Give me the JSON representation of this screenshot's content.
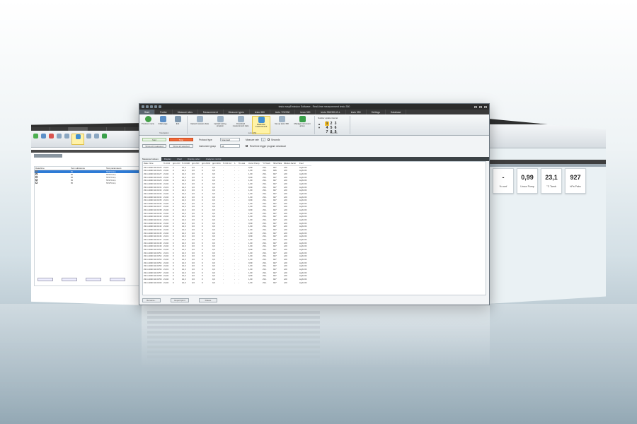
{
  "window": {
    "title": "testo easyEmission Software - Real-time measurement testo 350"
  },
  "menu": [
    {
      "label": "Start",
      "active": true
    },
    {
      "label": "Folder"
    },
    {
      "label": "Measure sites"
    },
    {
      "label": "Measurement"
    },
    {
      "label": "Measure types"
    },
    {
      "label": "testo 380"
    },
    {
      "label": "testo 720/330"
    },
    {
      "label": "testo 330"
    },
    {
      "label": "testo 330/330-2LL"
    },
    {
      "label": "testo 350"
    },
    {
      "label": "Settings"
    },
    {
      "label": "Database"
    }
  ],
  "ribbon": {
    "navigation": {
      "label": "Navigation",
      "buttons": [
        "Previous menu",
        "Initial page",
        "Exit"
      ]
    },
    "instrument": {
      "label": "testo 350",
      "buttons": [
        "Upload measure data",
        "Upload testing program",
        "Download measurement data",
        "Real-time measurement",
        "Set-up testo 350",
        "Manage instrument group"
      ]
    },
    "numpad": {
      "label": "Number update interval",
      "keys": [
        "1",
        "2",
        "3",
        "4",
        "5",
        "6",
        "7",
        "8",
        "9"
      ],
      "selected": "1",
      "group_label": "Specials"
    }
  },
  "controls": {
    "start": "Start",
    "stop": "Stop",
    "show_all_measured": "Show all measured",
    "show_all_selected": "Show all selected",
    "protocol_type_label": "Protocol type",
    "protocol_type_value": "Standard",
    "instrument_group_label": "Instrument group",
    "instrument_group_value": "All",
    "measure_rate_label": "Measure rate",
    "measure_rate_value": "1",
    "seconds_label": "Seconds",
    "trigger_label": "Real time trigger program download"
  },
  "tabs": [
    "Measured values",
    "Display",
    "Chart",
    "Display order",
    "Analyzer control"
  ],
  "table": {
    "headers": [
      "Date / time",
      "% CO2",
      "ppm CO",
      "% CO2R",
      "ppm NO",
      "ppm NO2",
      "ppm NOx",
      "% O2 Ind",
      "λ",
      "% Loss",
      "Uncor Pump",
      "°C Tamb",
      "hPa Pabs",
      "Dilution factor",
      "Fuel"
    ],
    "rows": [
      [
        "23.11.2020 11:02:25",
        "21,01",
        "0",
        "12,3",
        "0,0",
        "0",
        "0,0",
        "-",
        "-",
        "-",
        "0,99",
        "23,1",
        "927",
        "x20",
        "Light Oil"
      ],
      [
        "23.11.2020 11:02:26",
        "21,02",
        "0",
        "12,3",
        "0,0",
        "0",
        "0,0",
        "-",
        "-",
        "-",
        "1,00",
        "23,1",
        "926",
        "x20",
        "Light Oil"
      ],
      [
        "23.11.2020 11:02:27",
        "21,02",
        "0",
        "12,3",
        "0,0",
        "0",
        "0,0",
        "-",
        "-",
        "-",
        "1,00",
        "23,1",
        "927",
        "x20",
        "Light Oil"
      ],
      [
        "23.11.2020 11:02:28",
        "21,02",
        "0",
        "12,3",
        "0,0",
        "0",
        "0,0",
        "-",
        "-",
        "-",
        "0,99",
        "23,1",
        "927",
        "x20",
        "Light Oil"
      ],
      [
        "23.11.2020 11:02:29",
        "21,02",
        "0",
        "12,3",
        "0,0",
        "0",
        "0,0",
        "-",
        "-",
        "-",
        "1,00",
        "23,1",
        "927",
        "x20",
        "Light Oil"
      ],
      [
        "23.11.2020 11:02:30",
        "21,02",
        "0",
        "12,3",
        "0,0",
        "0",
        "0,0",
        "-",
        "-",
        "-",
        "1,00",
        "23,1",
        "927",
        "x20",
        "Light Oil"
      ],
      [
        "23.11.2020 11:02:31",
        "21,01",
        "0",
        "12,3",
        "0,0",
        "0",
        "0,0",
        "-",
        "-",
        "-",
        "0,99",
        "23,1",
        "927",
        "x20",
        "Light Oil"
      ],
      [
        "23.11.2020 11:02:32",
        "21,02",
        "0",
        "12,3",
        "0,0",
        "0",
        "0,0",
        "-",
        "-",
        "-",
        "1,00",
        "23,1",
        "927",
        "x20",
        "Light Oil"
      ],
      [
        "23.11.2020 11:02:33",
        "21,02",
        "0",
        "12,3",
        "0,0",
        "0",
        "0,0",
        "-",
        "-",
        "-",
        "1,00",
        "23,1",
        "927",
        "x20",
        "Light Oil"
      ],
      [
        "23.11.2020 11:02:34",
        "21,02",
        "0",
        "12,3",
        "0,0",
        "0",
        "0,0",
        "-",
        "-",
        "-",
        "1,00",
        "23,1",
        "927",
        "x20",
        "Light Oil"
      ],
      [
        "23.11.2020 11:02:35",
        "21,01",
        "0",
        "12,3",
        "0,0",
        "0",
        "0,0",
        "-",
        "-",
        "-",
        "0,99",
        "23,1",
        "927",
        "x20",
        "Light Oil"
      ],
      [
        "23.11.2020 11:02:36",
        "21,02",
        "0",
        "12,3",
        "0,0",
        "0",
        "0,0",
        "-",
        "-",
        "-",
        "1,00",
        "23,1",
        "927",
        "x20",
        "Light Oil"
      ],
      [
        "23.11.2020 11:02:37",
        "21,02",
        "0",
        "12,3",
        "0,0",
        "0",
        "0,0",
        "-",
        "-",
        "-",
        "1,00",
        "23,1",
        "927",
        "x20",
        "Light Oil"
      ],
      [
        "23.11.2020 11:02:38",
        "21,02",
        "0",
        "12,3",
        "0,0",
        "0",
        "0,0",
        "-",
        "-",
        "-",
        "0,99",
        "23,1",
        "927",
        "x20",
        "Light Oil"
      ],
      [
        "23.11.2020 11:02:39",
        "21,02",
        "0",
        "12,3",
        "0,0",
        "0",
        "0,0",
        "-",
        "-",
        "-",
        "1,00",
        "23,1",
        "927",
        "x20",
        "Light Oil"
      ],
      [
        "23.11.2020 11:02:40",
        "21,02",
        "0",
        "12,3",
        "0,0",
        "0",
        "0,0",
        "-",
        "-",
        "-",
        "1,00",
        "23,1",
        "927",
        "x20",
        "Light Oil"
      ],
      [
        "23.11.2020 11:02:41",
        "21,01",
        "0",
        "12,3",
        "0,0",
        "0",
        "0,0",
        "-",
        "-",
        "-",
        "1,00",
        "23,1",
        "927",
        "x20",
        "Light Oil"
      ],
      [
        "23.11.2020 11:02:42",
        "21,02",
        "0",
        "12,3",
        "0,0",
        "0",
        "0,0",
        "-",
        "-",
        "-",
        "0,99",
        "23,1",
        "927",
        "x20",
        "Light Oil"
      ],
      [
        "23.11.2020 11:02:43",
        "21,02",
        "0",
        "12,3",
        "0,0",
        "0",
        "0,0",
        "-",
        "-",
        "-",
        "1,00",
        "23,1",
        "927",
        "x20",
        "Light Oil"
      ],
      [
        "23.11.2020 11:02:44",
        "21,02",
        "0",
        "12,3",
        "0,0",
        "0",
        "0,0",
        "-",
        "-",
        "-",
        "1,00",
        "23,1",
        "927",
        "x20",
        "Light Oil"
      ],
      [
        "23.11.2020 11:02:45",
        "21,02",
        "0",
        "12,3",
        "0,0",
        "0",
        "0,0",
        "-",
        "-",
        "-",
        "1,00",
        "23,1",
        "927",
        "x20",
        "Light Oil"
      ],
      [
        "23.11.2020 11:02:46",
        "21,01",
        "0",
        "12,3",
        "0,0",
        "0",
        "0,0",
        "-",
        "-",
        "-",
        "0,99",
        "23,1",
        "927",
        "x20",
        "Light Oil"
      ],
      [
        "23.11.2020 11:02:47",
        "21,02",
        "0",
        "12,3",
        "0,0",
        "0",
        "0,0",
        "-",
        "-",
        "-",
        "1,00",
        "23,1",
        "927",
        "x20",
        "Light Oil"
      ],
      [
        "23.11.2020 11:02:48",
        "21,02",
        "0",
        "12,3",
        "0,0",
        "0",
        "0,0",
        "-",
        "-",
        "-",
        "1,00",
        "23,1",
        "927",
        "x20",
        "Light Oil"
      ],
      [
        "23.11.2020 11:02:49",
        "21,02",
        "0",
        "12,3",
        "0,0",
        "0",
        "0,0",
        "-",
        "-",
        "-",
        "1,00",
        "23,1",
        "927",
        "x20",
        "Light Oil"
      ],
      [
        "23.11.2020 11:02:50",
        "21,02",
        "0",
        "12,3",
        "0,0",
        "0",
        "0,0",
        "-",
        "-",
        "-",
        "0,99",
        "23,1",
        "927",
        "x20",
        "Light Oil"
      ],
      [
        "23.11.2020 11:02:51",
        "21,01",
        "0",
        "12,3",
        "0,0",
        "0",
        "0,0",
        "-",
        "-",
        "-",
        "1,00",
        "23,1",
        "927",
        "x20",
        "Light Oil"
      ],
      [
        "23.11.2020 11:02:52",
        "21,02",
        "0",
        "12,3",
        "0,0",
        "0",
        "0,0",
        "-",
        "-",
        "-",
        "1,00",
        "23,1",
        "927",
        "x20",
        "Light Oil"
      ],
      [
        "23.11.2020 11:02:53",
        "21,02",
        "0",
        "12,3",
        "0,0",
        "0",
        "0,0",
        "-",
        "-",
        "-",
        "1,00",
        "23,1",
        "927",
        "x20",
        "Light Oil"
      ],
      [
        "23.11.2020 11:02:54",
        "21,02",
        "0",
        "12,3",
        "0,0",
        "0",
        "0,0",
        "-",
        "-",
        "-",
        "0,99",
        "23,1",
        "927",
        "x20",
        "Light Oil"
      ],
      [
        "23.11.2020 11:02:55",
        "21,02",
        "0",
        "12,3",
        "0,0",
        "0",
        "0,0",
        "-",
        "-",
        "-",
        "1,00",
        "23,1",
        "927",
        "x20",
        "Light Oil"
      ],
      [
        "23.11.2020 11:02:56",
        "21,01",
        "0",
        "12,3",
        "0,0",
        "0",
        "0,0",
        "-",
        "-",
        "-",
        "1,00",
        "23,1",
        "927",
        "x20",
        "Light Oil"
      ],
      [
        "23.11.2020 11:02:57",
        "21,02",
        "0",
        "12,3",
        "0,0",
        "0",
        "0,0",
        "-",
        "-",
        "-",
        "1,00",
        "23,1",
        "927",
        "x20",
        "Light Oil"
      ],
      [
        "23.11.2020 11:02:58",
        "21,02",
        "0",
        "12,3",
        "0,0",
        "0",
        "0,0",
        "-",
        "-",
        "-",
        "0,99",
        "23,1",
        "927",
        "x20",
        "Light Oil"
      ],
      [
        "23.11.2020 11:02:59",
        "21,02",
        "0",
        "12,3",
        "0,0",
        "0",
        "0,0",
        "-",
        "-",
        "-",
        "1,00",
        "23,1",
        "927",
        "x20",
        "Light Oil"
      ],
      [
        "23.11.2020 11:03:00",
        "21,02",
        "0",
        "12,3",
        "0,0",
        "0",
        "0,0",
        "-",
        "-",
        "-",
        "1,00",
        "23,1",
        "927",
        "x20",
        "Light Oil"
      ]
    ]
  },
  "footer": [
    "Rename...",
    "Export/print",
    "Delete"
  ],
  "left_window": {
    "headers": [
      "Date/time",
      "Test substance",
      "Test parameters"
    ],
    "rows": [
      {
        "cells": [
          "",
          "B1",
          "TEST1.bmp"
        ],
        "selected": true
      },
      {
        "cells": [
          "",
          "B2",
          "TEST2.bmp"
        ]
      },
      {
        "cells": [
          "",
          "B3",
          "TEST3.bmp"
        ]
      },
      {
        "cells": [
          "",
          "B4",
          "TEST4.bmp"
        ]
      },
      {
        "cells": [
          "",
          "B5",
          "TEST5.bmp"
        ]
      }
    ]
  },
  "right_window": {
    "tiles": [
      {
        "value": "-",
        "unit": "% conf"
      },
      {
        "value": "0,99",
        "unit": "Uncor Pump"
      },
      {
        "value": "23,1",
        "unit": "°C Tamb"
      },
      {
        "value": "927",
        "unit": "hPa Pabs"
      }
    ]
  },
  "colors": {
    "accent_stop": "#f26b3a",
    "highlight": "#fff3a6",
    "selection": "#2e7bd6",
    "titlebar": "#2b2b2b"
  },
  "icons": {
    "navigation": [
      "back-arrow-icon",
      "home-icon",
      "exit-icon"
    ],
    "instrument": [
      "upload-data-icon",
      "upload-program-icon",
      "download-data-icon",
      "realtime-icon",
      "setup-icon",
      "instrument-group-icon"
    ]
  }
}
